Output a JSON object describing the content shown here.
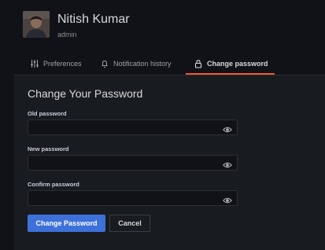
{
  "profile": {
    "name": "Nitish Kumar",
    "role": "admin",
    "avatar_icon": "user-avatar"
  },
  "tabs": [
    {
      "label": "Preferences",
      "icon": "sliders-icon",
      "active": false
    },
    {
      "label": "Notification history",
      "icon": "bell-icon",
      "active": false
    },
    {
      "label": "Change password",
      "icon": "lock-icon",
      "active": true
    }
  ],
  "form": {
    "title": "Change Your Password",
    "fields": [
      {
        "label": "Old password",
        "value": "",
        "placeholder": ""
      },
      {
        "label": "New password",
        "value": "",
        "placeholder": ""
      },
      {
        "label": "Confirm password",
        "value": "",
        "placeholder": ""
      }
    ],
    "submit_label": "Change Password",
    "cancel_label": "Cancel"
  },
  "colors": {
    "background": "#111217",
    "panel": "#181b1f",
    "accent_underline": "#f05a28",
    "primary_button": "#3d71d9"
  }
}
